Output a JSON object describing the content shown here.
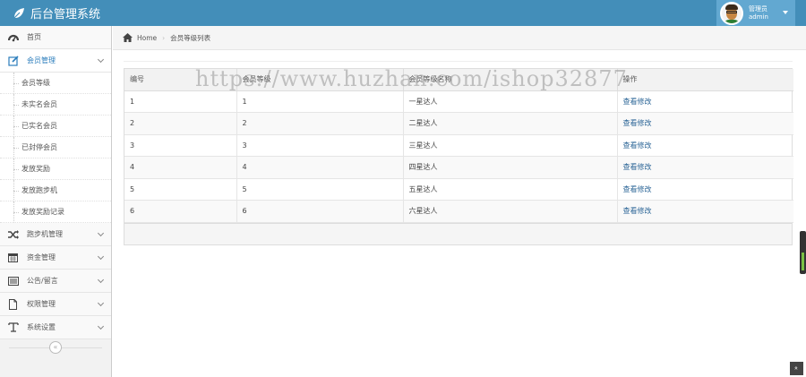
{
  "app": {
    "title": "后台管理系统",
    "user_role": "管理员",
    "user_name": "admin"
  },
  "sidebar": {
    "items": [
      {
        "label": "首页",
        "icon": "dashboard-icon"
      },
      {
        "label": "会员管理",
        "icon": "edit-icon"
      },
      {
        "label": "跑步机管理",
        "icon": "random-icon"
      },
      {
        "label": "资金管理",
        "icon": "calendar-icon"
      },
      {
        "label": "公告/留言",
        "icon": "list-icon"
      },
      {
        "label": "权限管理",
        "icon": "file-icon"
      },
      {
        "label": "系统设置",
        "icon": "text-icon"
      }
    ],
    "sub_items": [
      "会员等级",
      "未实名会员",
      "已实名会员",
      "已封停会员",
      "发放奖励",
      "发放跑步机",
      "发放奖励记录"
    ],
    "collapse_glyph": "«"
  },
  "breadcrumb": {
    "home": "Home",
    "current": "会员等级列表"
  },
  "table": {
    "headers": [
      "编号",
      "会员等级",
      "会员等级名称",
      "操作"
    ],
    "rows": [
      [
        "1",
        "1",
        "一星达人",
        "查看修改"
      ],
      [
        "2",
        "2",
        "二星达人",
        "查看修改"
      ],
      [
        "3",
        "3",
        "三星达人",
        "查看修改"
      ],
      [
        "4",
        "4",
        "四星达人",
        "查看修改"
      ],
      [
        "5",
        "5",
        "五星达人",
        "查看修改"
      ],
      [
        "6",
        "6",
        "六星达人",
        "查看修改"
      ]
    ]
  },
  "watermark": "https://www.huzhan.com/ishop32877",
  "back_to_top_glyph": "»",
  "colors": {
    "navbar": "#438eb9",
    "user_box": "#62a8d1",
    "link": "#2a6496",
    "active_nav": "#2b7dbc"
  }
}
